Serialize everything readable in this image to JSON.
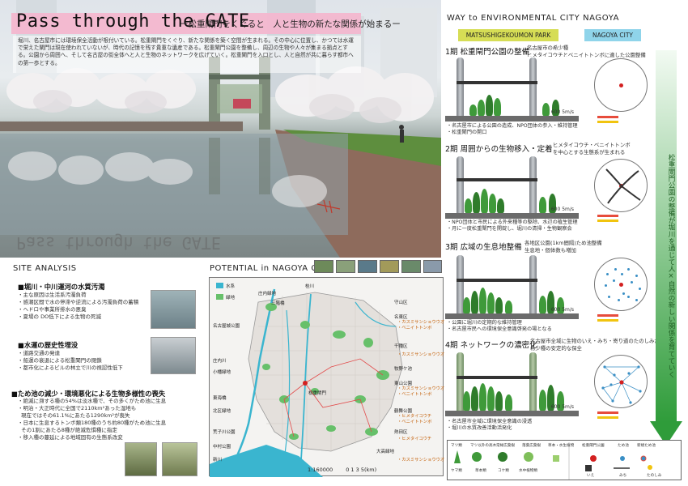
{
  "hero": {
    "title": "Pass through the GATE",
    "subtitle": "ー松重閘門をくぐると　人と生物の新たな関係が始まるー",
    "lead": "堀川、名古屋市には環境保全活動が根付いている。松重閘門をくぐり、新たな関係を築く空間が生まれる。その中心に位置し、かつては水運で栄えた閘門は現在使われていないが、時代の記憶を残す貴重な遺産である。松重閘門公園を整備し、周辺の生物や人々が集まる拠点とする。公園から周囲へ、そして名古屋の街全体へと人と生物のネットワークを広げていく。松重閘門を入口とし、人と自然が共に暮らす都市への第一歩とする。",
    "reflection_title": "Pass through the GATE"
  },
  "way": {
    "heading": "WAY to ENVIRONMENTAL  CITY  NAGOYA",
    "tag_park": "MATSUSHIGEKOUMON PARK",
    "tag_city": "NAGOYA CITY",
    "phases": [
      {
        "title": "1期  松重閘門公園の整備",
        "caption": "名古屋市の希少種\nヒメタイコウチとベニイトトンボに適した公園整備",
        "bullets": "・名古屋市による公園の造成、NPO団体の参入・維持管理\n・松重閘門の開口",
        "water": "600 5m/s"
      },
      {
        "title": "2期  周囲からの生物移入・定着",
        "caption": "ヒメタイコウチ・ベニイトトンボ\nを中心とする生態系が生まれる",
        "bullets": "・NPO団体と市民による外来種等の駆除、水辺の植生管理\n・月に一度松重閘門を開錠し、堀川の清掃・生物観察会",
        "water": "600 5m/s"
      },
      {
        "title": "3期  広域の生息地整備",
        "caption": "各地区公園(1km間隔)ため池整備\n生息地・個体数も増加",
        "bullets": "・公園に堀川の定期的な維持管理\n・名古屋市民への環境保全意識啓発の場となる",
        "water": "600 5m/s"
      },
      {
        "title": "4期  ネットワークの濃密化",
        "caption": "名古屋市全域に生物のいえ・みち・寄り道のたのしみが増え、\n希少種の安定的な保全",
        "bullets": "・名古屋市全域に環境保全意識の浸透\n・堀川の水質改善活動活発化",
        "water": "600 5m/s"
      }
    ],
    "arrow_text": "松重閘門公園の整備が堀川を通じて人×自然の新しい関係を育てていく"
  },
  "legend": {
    "items": [
      "マツ類",
      "マツ以外の高木",
      "常緑広葉樹",
      "落葉広葉樹",
      "草本・水生植物",
      "ヤマ類",
      "草本類",
      "コケ類",
      "水中植物類",
      "松重閘門公園",
      "ため池",
      "新規ため池",
      "いえ",
      "みち",
      "たのしみ"
    ]
  },
  "site": {
    "heading": "SITE ANALYSIS",
    "sections": [
      {
        "head": "■堀川・中川運河の水質汚濁",
        "items": "・主な原因は生活系汚濁負荷\n・感潮区間で水の停滞や逆流による汚濁負荷の蓄積\n・ヘドロや事業所排水の悪臭\n・夏場の DO低下による生物の死滅"
      },
      {
        "head": "■水運の歴史性埋没",
        "items": "・道路交通の発達\n・船運の衰退による松重閘門の閉鎖\n・都市化によるビルの林立で川の視認性低下"
      },
      {
        "head": "■ため池の減少・環境悪化による生物多様性の喪失",
        "items": "・絶滅に瀕する種の54%は淡水種で、その多くがため池に生息\n・明治・大正時代に全国で2110km²あった湿地も\n  現在ではその61.1%にあたる1290km²が喪失\n・日本に生息するトンボ類180種のうち約80種がため池に生息\n  その1割にあたる8種が絶滅危惧種に指定\n・移入種の蔓延による地域固有の生態系改変"
      }
    ]
  },
  "potential": {
    "heading": "POTENTIAL  in  NAGOYA  CITY",
    "legend_water": "水系",
    "legend_green": "緑地",
    "scale": "1:160000",
    "scale_marks": "0  1   3   5(km)",
    "place_labels": [
      "庄内緑地",
      "桂川",
      "三階橋",
      "名古屋城公園",
      "庄内川",
      "松重閘門",
      "小幡緑地",
      "東山公園",
      "東海橋",
      "北区緑地",
      "大高緑地",
      "荒子川公園",
      "中村公園",
      "牧野ケ池",
      "新川",
      "鶴舞公園",
      "名東区",
      "守山区",
      "千種区",
      "熱田区"
    ],
    "notes": [
      "・カスミサンショウウオ\n・ベニイトトンボ",
      "・カスミサンショウウオ",
      "・カスミサンショウウオ\n・ベニイトトンボ",
      "・ヒメタイコウチ\n・ベニイトトンボ",
      "・ヒメタイコウチ",
      "・カスミサンショウウオ"
    ]
  }
}
